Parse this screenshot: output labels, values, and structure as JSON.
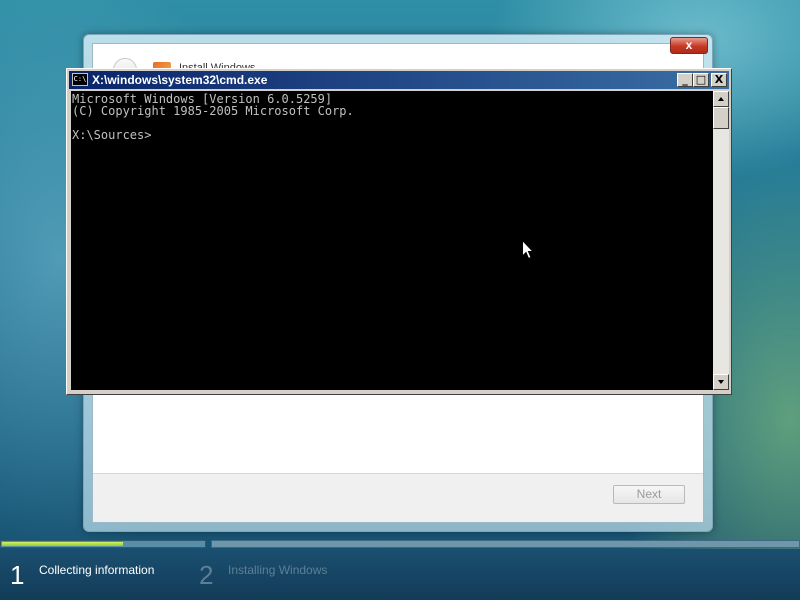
{
  "setup_window": {
    "title": "Install Windows",
    "close_label": "x",
    "next_label": "Next"
  },
  "cmd_window": {
    "title": "X:\\windows\\system32\\cmd.exe",
    "icon_text": "C:\\",
    "minimize_label": "_",
    "maximize_label": "□",
    "close_label": "X",
    "console_lines": [
      "Microsoft Windows [Version 6.0.5259]",
      "(C) Copyright 1985-2005 Microsoft Corp.",
      "",
      "X:\\Sources>"
    ]
  },
  "progress": {
    "fraction": 0.6
  },
  "steps": [
    {
      "number": "1",
      "label": "Collecting information",
      "state": "active"
    },
    {
      "number": "2",
      "label": "Installing Windows",
      "state": "inactive"
    }
  ],
  "colors": {
    "console_bg": "#000000",
    "console_text": "#c0c0c0",
    "titlebar_start": "#0a246a",
    "titlebar_end": "#3a6ea5",
    "progress_fill": "#9acb2c"
  },
  "icons": {
    "cmd": "cmd-icon",
    "pointer": "mouse-pointer-icon"
  }
}
